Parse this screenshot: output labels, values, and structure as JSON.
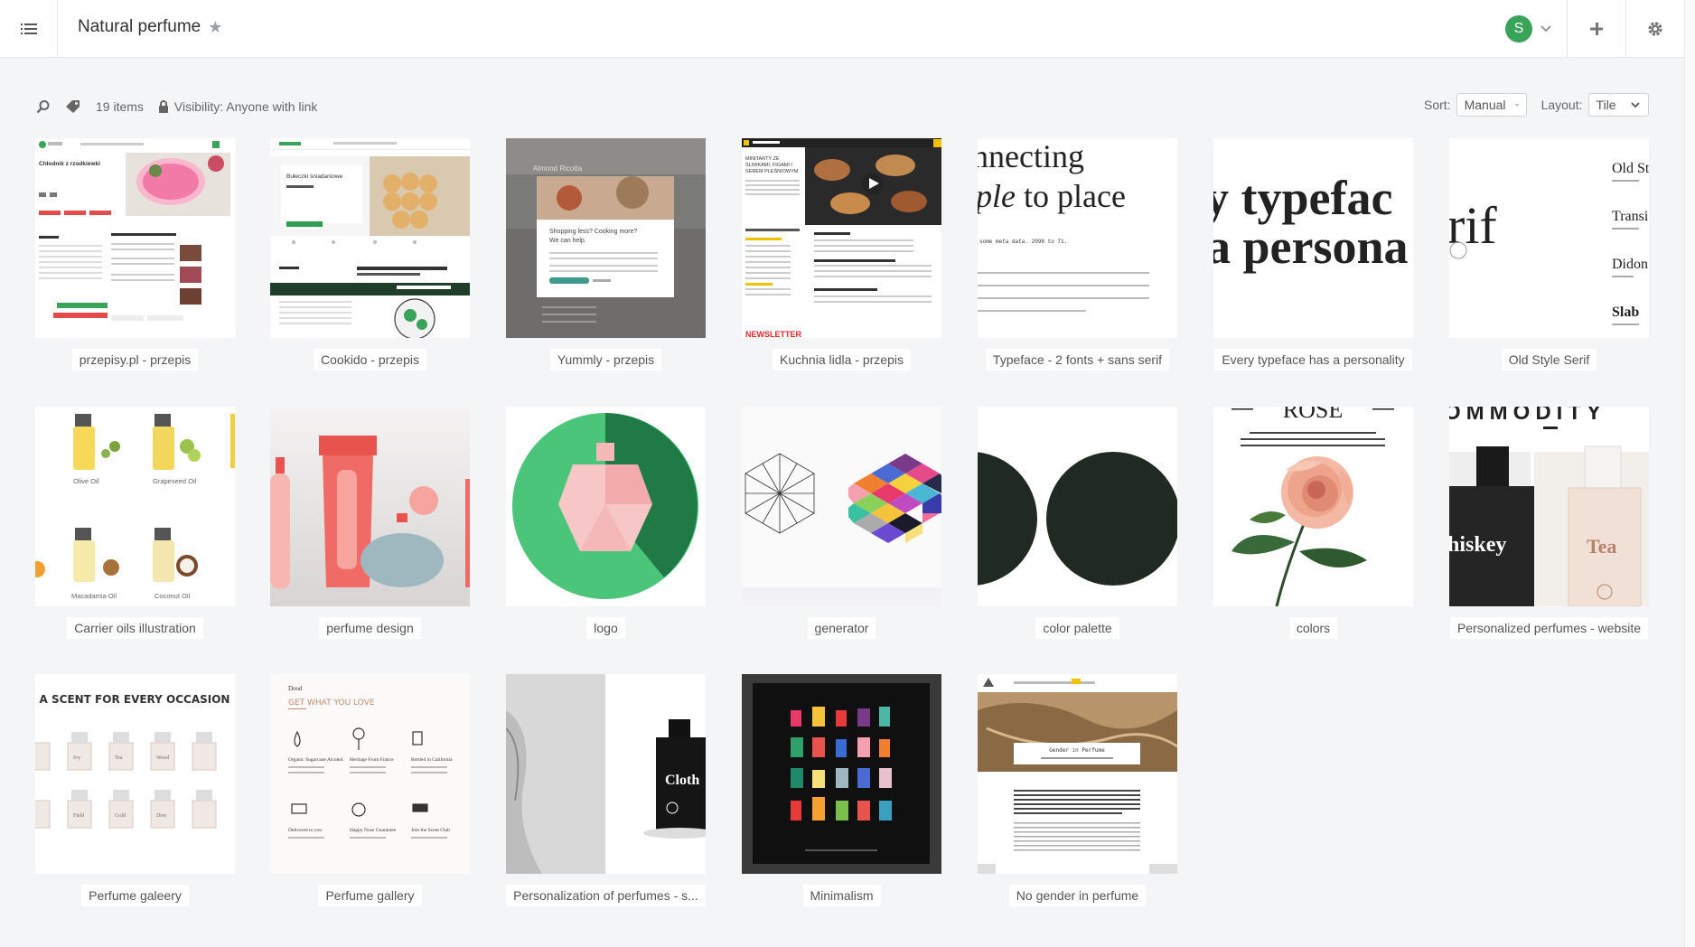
{
  "header": {
    "title": "Natural perfume",
    "avatar_letter": "S",
    "avatar_color": "#3aa35a"
  },
  "toolbar": {
    "item_count": "19 items",
    "visibility": "Visibility: Anyone with link",
    "sort_label": "Sort:",
    "sort_value": "Manual",
    "layout_label": "Layout:",
    "layout_value": "Tile"
  },
  "items": [
    {
      "label": "przepisy.pl - przepis",
      "thumb_text": "Chłodnik z rzodkiewki"
    },
    {
      "label": "Cookido - przepis",
      "thumb_text": "Bułeczki śniadaniowe"
    },
    {
      "label": "Yummly - przepis",
      "thumb_text": "Shopping less? Cooking more? We can help."
    },
    {
      "label": "Kuchnia lidla - przepis",
      "thumb_text": "MINITARTY ZE ŚLIWKAMI, FIGAMI I SEREM PLEŚNIOWYM"
    },
    {
      "label": "Typeface - 2 fonts + sans serif",
      "thumb_text": "nnecting ple to place"
    },
    {
      "label": "Every typeface has a personality",
      "thumb_text": "y typefac a persona"
    },
    {
      "label": "Old Style Serif",
      "thumb_text": "rif"
    },
    {
      "label": "Carrier oils illustration",
      "thumb_text": "Olive Oil"
    },
    {
      "label": "perfume design",
      "thumb_text": ""
    },
    {
      "label": "logo",
      "thumb_text": ""
    },
    {
      "label": "generator",
      "thumb_text": ""
    },
    {
      "label": "color palette",
      "thumb_text": ""
    },
    {
      "label": "colors",
      "thumb_text": "ROSE"
    },
    {
      "label": "Personalized perfumes - website",
      "thumb_text": "OMMODITY"
    },
    {
      "label": "Perfume galeery",
      "thumb_text": "A SCENT FOR EVERY OCCASION"
    },
    {
      "label": "Perfume gallery",
      "thumb_text": "GET WHAT YOU LOVE"
    },
    {
      "label": "Personalization of perfumes - s...",
      "thumb_text": "Cloth"
    },
    {
      "label": "Minimalism",
      "thumb_text": ""
    },
    {
      "label": "No gender in perfume",
      "thumb_text": "Gender in Perfume"
    }
  ],
  "thumb_texts_extra": {
    "oils": [
      "Olive Oil",
      "Grapeseed Oil",
      "Macadamia Oil",
      "Coconut Oil"
    ],
    "old_style": [
      "Old St",
      "Transi",
      "Didon",
      "Slab"
    ],
    "scents": [
      "Ivy",
      "Tea",
      "Wood",
      "Field",
      "Gold",
      "Dew"
    ],
    "gallery": [
      "Organic Sugarcane Alcohol",
      "Heritage From France",
      "Bottled in California",
      "Delivered to you",
      "Happy Nose Guarantee",
      "Join the Scent Club"
    ],
    "perfume_names": [
      "hiskey",
      "Tea"
    ]
  }
}
